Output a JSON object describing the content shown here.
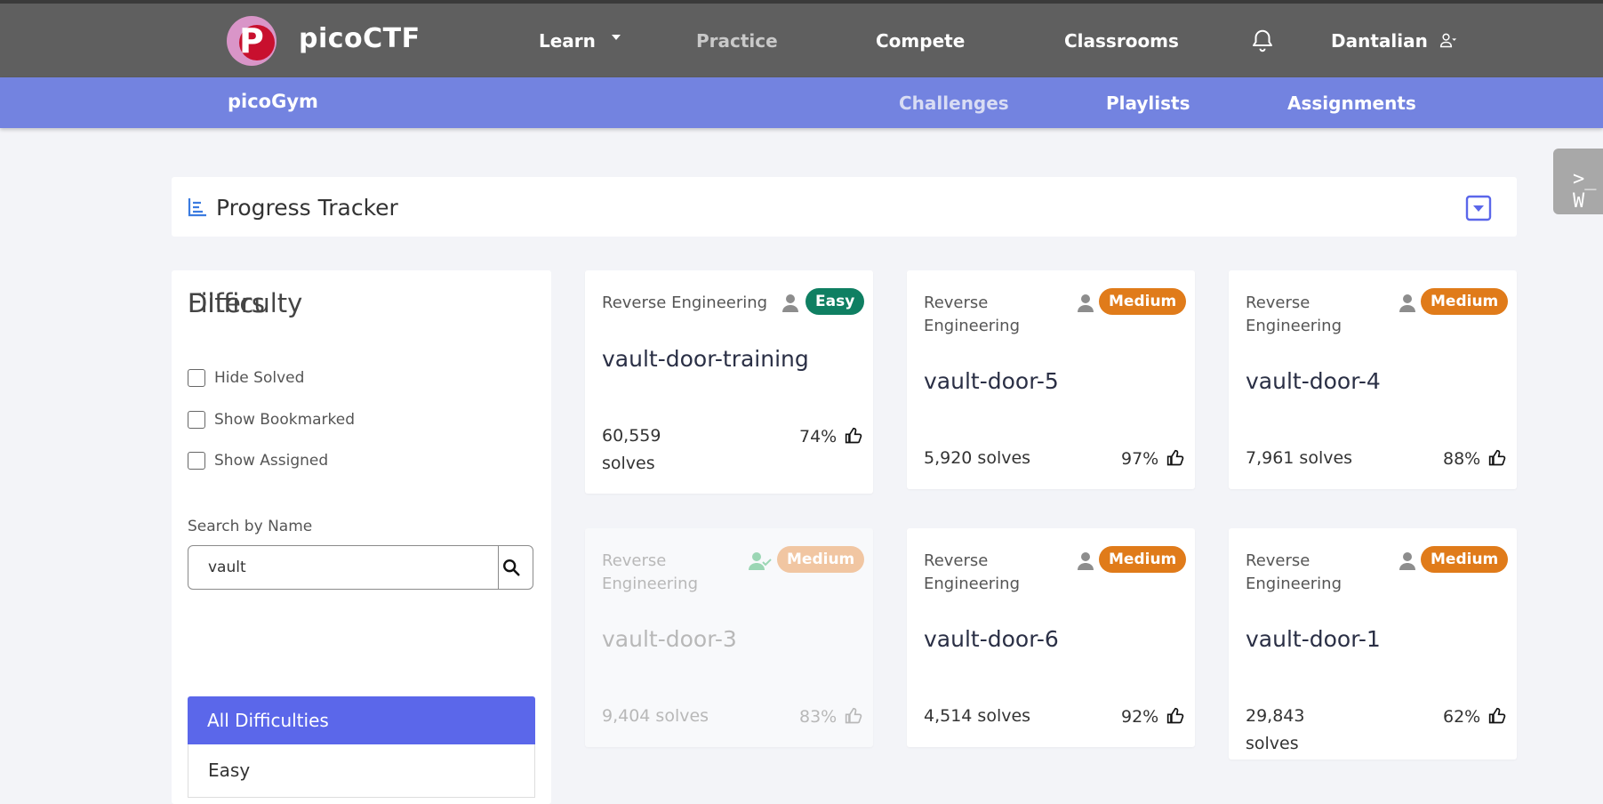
{
  "nav": {
    "brand": "picoCTF",
    "learn": "Learn",
    "practice": "Practice",
    "compete": "Compete",
    "classrooms": "Classrooms",
    "user": "Dantalian"
  },
  "subnav": {
    "title": "picoGym",
    "challenges": "Challenges",
    "playlists": "Playlists",
    "assignments": "Assignments"
  },
  "webshell": {
    "label": ">_ W"
  },
  "progress": {
    "title": "Progress Tracker"
  },
  "filters": {
    "title": "Filters",
    "hide_solved": "Hide Solved",
    "show_bookmarked": "Show Bookmarked",
    "show_assigned": "Show Assigned",
    "search_label": "Search by Name",
    "search_value": "vault",
    "difficulty_title": "Difficulty",
    "difficulty_options": [
      "All Difficulties",
      "Easy"
    ]
  },
  "colors": {
    "easy": "#0f7f62",
    "medium": "#e07b1a",
    "medium_faded": "#f1c6a2",
    "accent": "#5b67ea",
    "navbar": "#5f5f5f",
    "subnav": "#7383e0"
  },
  "cards": [
    {
      "category": "Reverse Engineering",
      "difficulty": "Easy",
      "name": "vault-door-training",
      "solves": "60,559 solves",
      "rating": "74%",
      "solved": false
    },
    {
      "category": "Reverse Engineering",
      "difficulty": "Medium",
      "name": "vault-door-5",
      "solves": "5,920 solves",
      "rating": "97%",
      "solved": false
    },
    {
      "category": "Reverse Engineering",
      "difficulty": "Medium",
      "name": "vault-door-4",
      "solves": "7,961 solves",
      "rating": "88%",
      "solved": false
    },
    {
      "category": "Reverse Engineering",
      "difficulty": "Medium",
      "name": "vault-door-3",
      "solves": "9,404 solves",
      "rating": "83%",
      "solved": true
    },
    {
      "category": "Reverse Engineering",
      "difficulty": "Medium",
      "name": "vault-door-6",
      "solves": "4,514 solves",
      "rating": "92%",
      "solved": false
    },
    {
      "category": "Reverse Engineering",
      "difficulty": "Medium",
      "name": "vault-door-1",
      "solves": "29,843 solves",
      "rating": "62%",
      "solved": false
    }
  ]
}
